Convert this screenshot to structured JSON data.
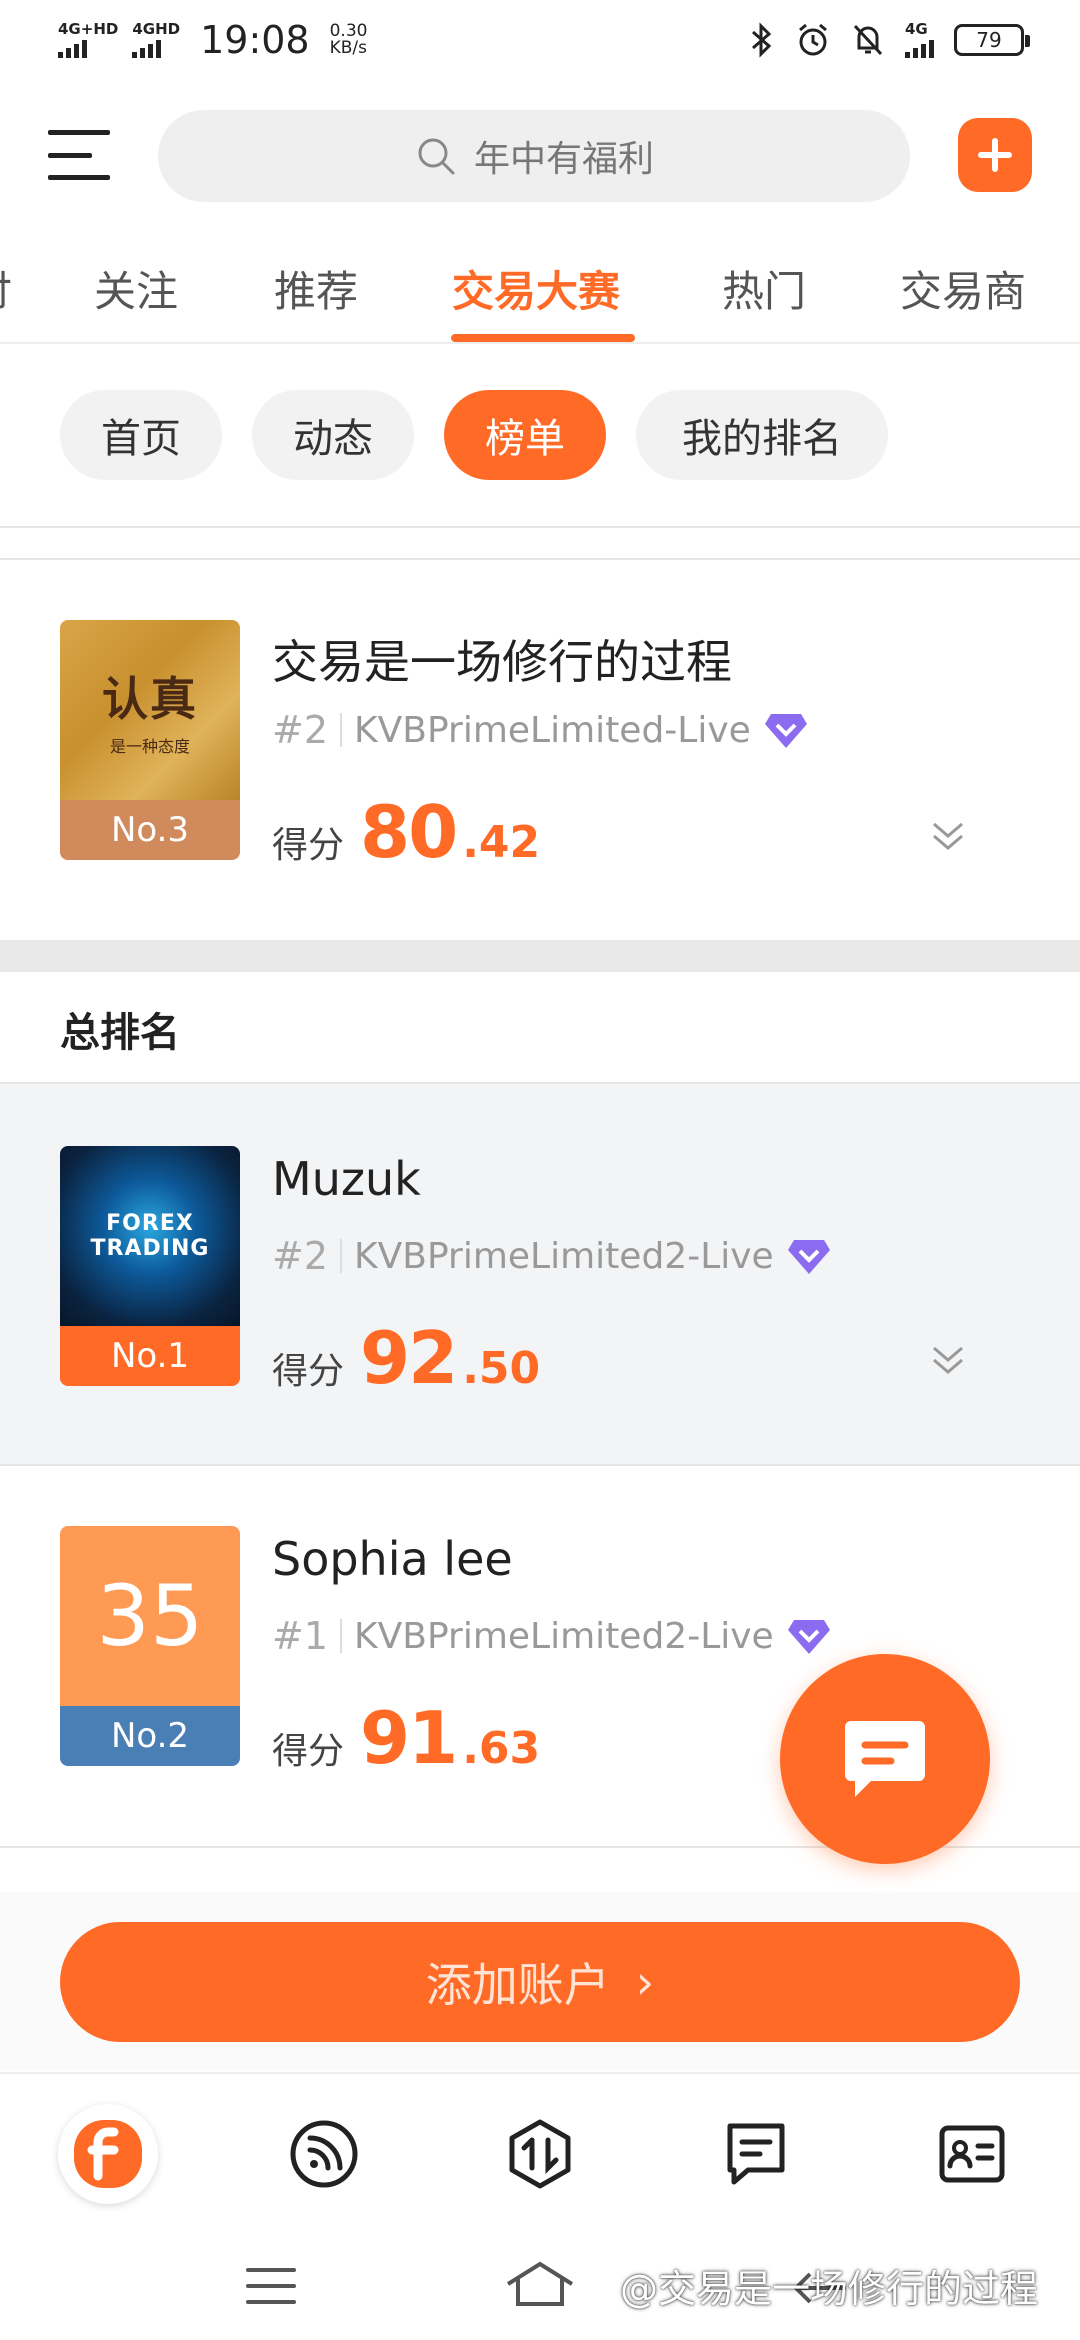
{
  "status_bar": {
    "net1": "4G+HD",
    "net2": "4GHD",
    "time": "19:08",
    "speed_value": "0.30",
    "speed_unit": "KB/s",
    "net3": "4G",
    "battery": "79"
  },
  "header": {
    "search_placeholder": "年中有福利"
  },
  "tabs": [
    {
      "label": "讨"
    },
    {
      "label": "关注"
    },
    {
      "label": "推荐"
    },
    {
      "label": "交易大赛"
    },
    {
      "label": "热门"
    },
    {
      "label": "交易商"
    }
  ],
  "chips": [
    {
      "label": "首页"
    },
    {
      "label": "动态"
    },
    {
      "label": "榜单"
    },
    {
      "label": "我的排名"
    }
  ],
  "my_entry": {
    "name": "交易是一场修行的过程",
    "rank_label": "#2",
    "server": "KVBPrimeLimited-Live",
    "badge": "No.3",
    "score_label": "得分",
    "score_int": "80",
    "score_dec": ".42",
    "thumb_text_main": "认真",
    "thumb_text_sub": "是一种态度"
  },
  "section": {
    "title": "总排名"
  },
  "ranking": [
    {
      "name": "Muzuk",
      "rank_label": "#2",
      "server": "KVBPrimeLimited2-Live",
      "badge": "No.1",
      "score_label": "得分",
      "score_int": "92",
      "score_dec": ".50",
      "thumb_text_1": "FOREX",
      "thumb_text_2": "TRADING"
    },
    {
      "name": "Sophia lee",
      "rank_label": "#1",
      "server": "KVBPrimeLimited2-Live",
      "badge": "No.2",
      "score_label": "得分",
      "score_int": "91",
      "score_dec": ".63",
      "thumb_text": "35"
    }
  ],
  "add_account": {
    "label": "添加账户",
    "arrow": "›"
  },
  "watermark": "@交易是一场修行的过程",
  "colors": {
    "accent": "#ff6b27",
    "badge_no1": "#ff6b27",
    "badge_no2": "#4a7fb5",
    "badge_no3": "#d08a5c",
    "thumb_no2_bg": "#ff9a55",
    "verified": "#8b6cf0"
  },
  "icons": {
    "menu": "menu-icon",
    "search": "search-icon",
    "add": "plus-icon",
    "verified": "verified-diamond-icon",
    "expand": "double-chevron-down-icon",
    "chat": "chat-bubble-icon",
    "nav": [
      "home-logo-icon",
      "feed-rss-icon",
      "trade-arrows-icon",
      "messages-icon",
      "profile-card-icon"
    ]
  }
}
